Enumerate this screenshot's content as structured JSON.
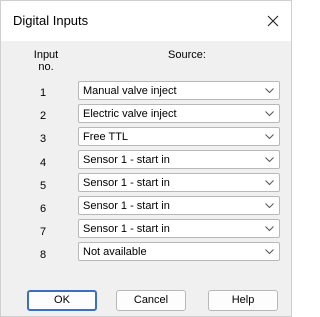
{
  "window": {
    "title": "Digital Inputs"
  },
  "headers": {
    "input_no_line1": "Input",
    "input_no_line2": "no.",
    "source": "Source:"
  },
  "rows": [
    {
      "number": "1",
      "source": "Manual valve inject"
    },
    {
      "number": "2",
      "source": "Electric valve inject"
    },
    {
      "number": "3",
      "source": "Free TTL"
    },
    {
      "number": "4",
      "source": "Sensor 1 - start in"
    },
    {
      "number": "5",
      "source": "Sensor 1 - start in"
    },
    {
      "number": "6",
      "source": "Sensor 1 - start in"
    },
    {
      "number": "7",
      "source": "Sensor 1 - start in"
    },
    {
      "number": "8",
      "source": "Not available"
    }
  ],
  "buttons": {
    "ok": "OK",
    "cancel": "Cancel",
    "help": "Help"
  },
  "icons": {
    "close": "close-icon",
    "dropdown": "chevron-down-icon"
  },
  "colors": {
    "default_button_border": "#3a6fc4",
    "dialog_background": "#f0f0f0"
  }
}
